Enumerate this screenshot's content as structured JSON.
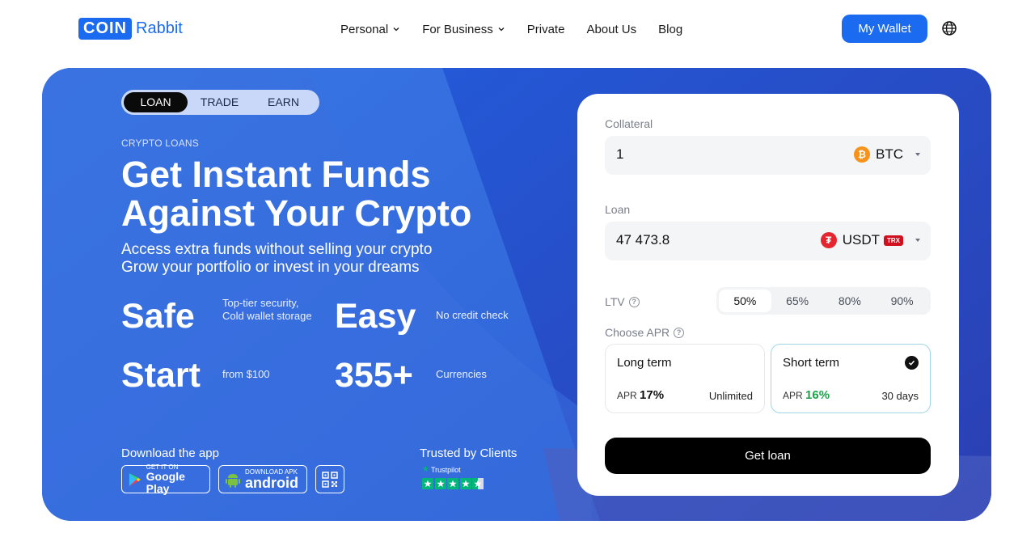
{
  "header": {
    "logo_box": "COIN",
    "logo_text": "Rabbit",
    "nav": [
      {
        "label": "Personal",
        "has_dropdown": true
      },
      {
        "label": "For Business",
        "has_dropdown": true
      },
      {
        "label": "Private",
        "has_dropdown": false
      },
      {
        "label": "About Us",
        "has_dropdown": false
      },
      {
        "label": "Blog",
        "has_dropdown": false
      }
    ],
    "wallet_button": "My Wallet",
    "language_icon": "globe-icon"
  },
  "hero": {
    "tabs": [
      {
        "label": "LOAN",
        "active": true
      },
      {
        "label": "TRADE",
        "active": false
      },
      {
        "label": "EARN",
        "active": false
      }
    ],
    "eyebrow": "CRYPTO LOANS",
    "headline_line1": "Get Instant Funds",
    "headline_line2": "Against Your Crypto",
    "sub_line1": "Access extra funds without selling your crypto",
    "sub_line2": "Grow your portfolio or invest in your dreams",
    "stats": [
      {
        "big": "Safe",
        "small": "Top-tier security, Cold wallet storage"
      },
      {
        "big": "Easy",
        "small": "No credit check"
      },
      {
        "big": "Start",
        "small": "from $100"
      },
      {
        "big": "355+",
        "small": "Currencies"
      }
    ],
    "download_label": "Download the app",
    "google_play": {
      "small": "GET IT ON",
      "big": "Google Play"
    },
    "android_apk": {
      "small": "DOWNLOAD APK",
      "big": "android"
    },
    "trust_label": "Trusted by Clients",
    "trustpilot_name": "Trustpilot",
    "trustpilot_stars": 4.5
  },
  "loan_form": {
    "collateral_label": "Collateral",
    "collateral_value": "1",
    "collateral_currency": "BTC",
    "loan_label": "Loan",
    "loan_value": "47 473.8",
    "loan_currency": "USDT",
    "loan_network": "TRX",
    "ltv_label": "LTV",
    "ltv_options": [
      "50%",
      "65%",
      "80%",
      "90%"
    ],
    "ltv_selected": "50%",
    "apr_label": "Choose APR",
    "apr_options": [
      {
        "title": "Long term",
        "apr_prefix": "APR",
        "apr": "17%",
        "term": "Unlimited",
        "selected": false
      },
      {
        "title": "Short term",
        "apr_prefix": "APR",
        "apr": "16%",
        "term": "30 days",
        "selected": true
      }
    ],
    "submit_label": "Get loan"
  },
  "colors": {
    "brand_blue": "#1a6bf0",
    "hero_blue": "#2c63d8",
    "trustpilot_green": "#00b67a",
    "apr_green": "#18a34a"
  }
}
